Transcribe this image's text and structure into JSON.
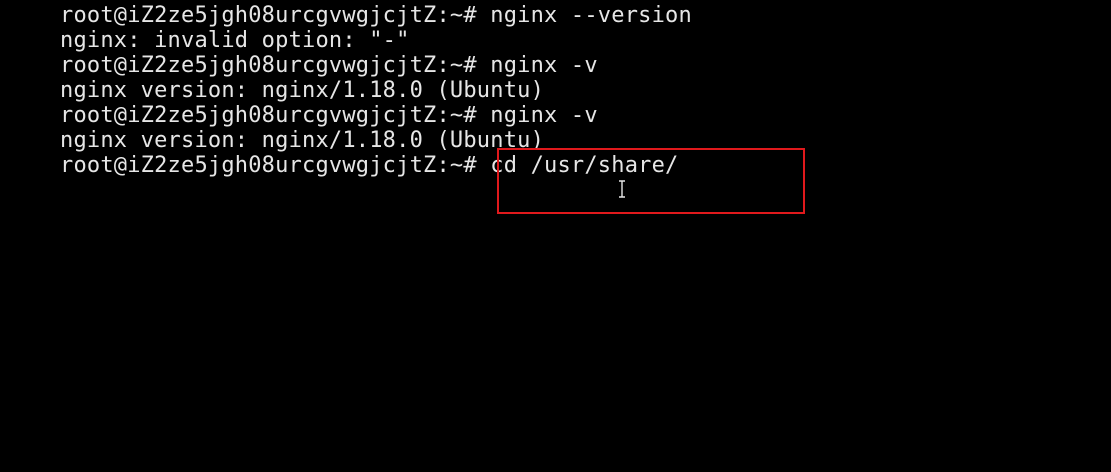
{
  "terminal": {
    "lines": [
      "root@iZ2ze5jgh08urcgvwgjcjtZ:~# nginx --version",
      "nginx: invalid option: \"-\"",
      "root@iZ2ze5jgh08urcgvwgjcjtZ:~# nginx -v",
      "nginx version: nginx/1.18.0 (Ubuntu)",
      "root@iZ2ze5jgh08urcgvwgjcjtZ:~# nginx -v",
      "nginx version: nginx/1.18.0 (Ubuntu)",
      "root@iZ2ze5jgh08urcgvwgjcjtZ:~# cd /usr/share/"
    ]
  },
  "colors": {
    "background": "#000000",
    "text": "#e6e6e6",
    "highlight_border": "#e0191c"
  },
  "icons": {
    "text_cursor": "i-beam-cursor-icon"
  }
}
